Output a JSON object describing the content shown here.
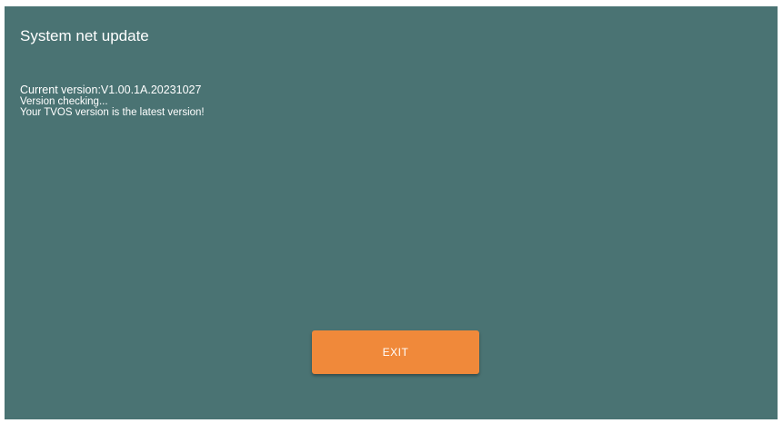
{
  "colors": {
    "background": "#4a7373",
    "accent": "#f0893a",
    "text": "#ffffff"
  },
  "header": {
    "title": "System net update"
  },
  "status": {
    "lines": [
      "Current version:V1.00.1A.20231027",
      "Version checking...",
      "Your TVOS version is the latest version!"
    ]
  },
  "actions": {
    "exit_label": "EXIT"
  }
}
